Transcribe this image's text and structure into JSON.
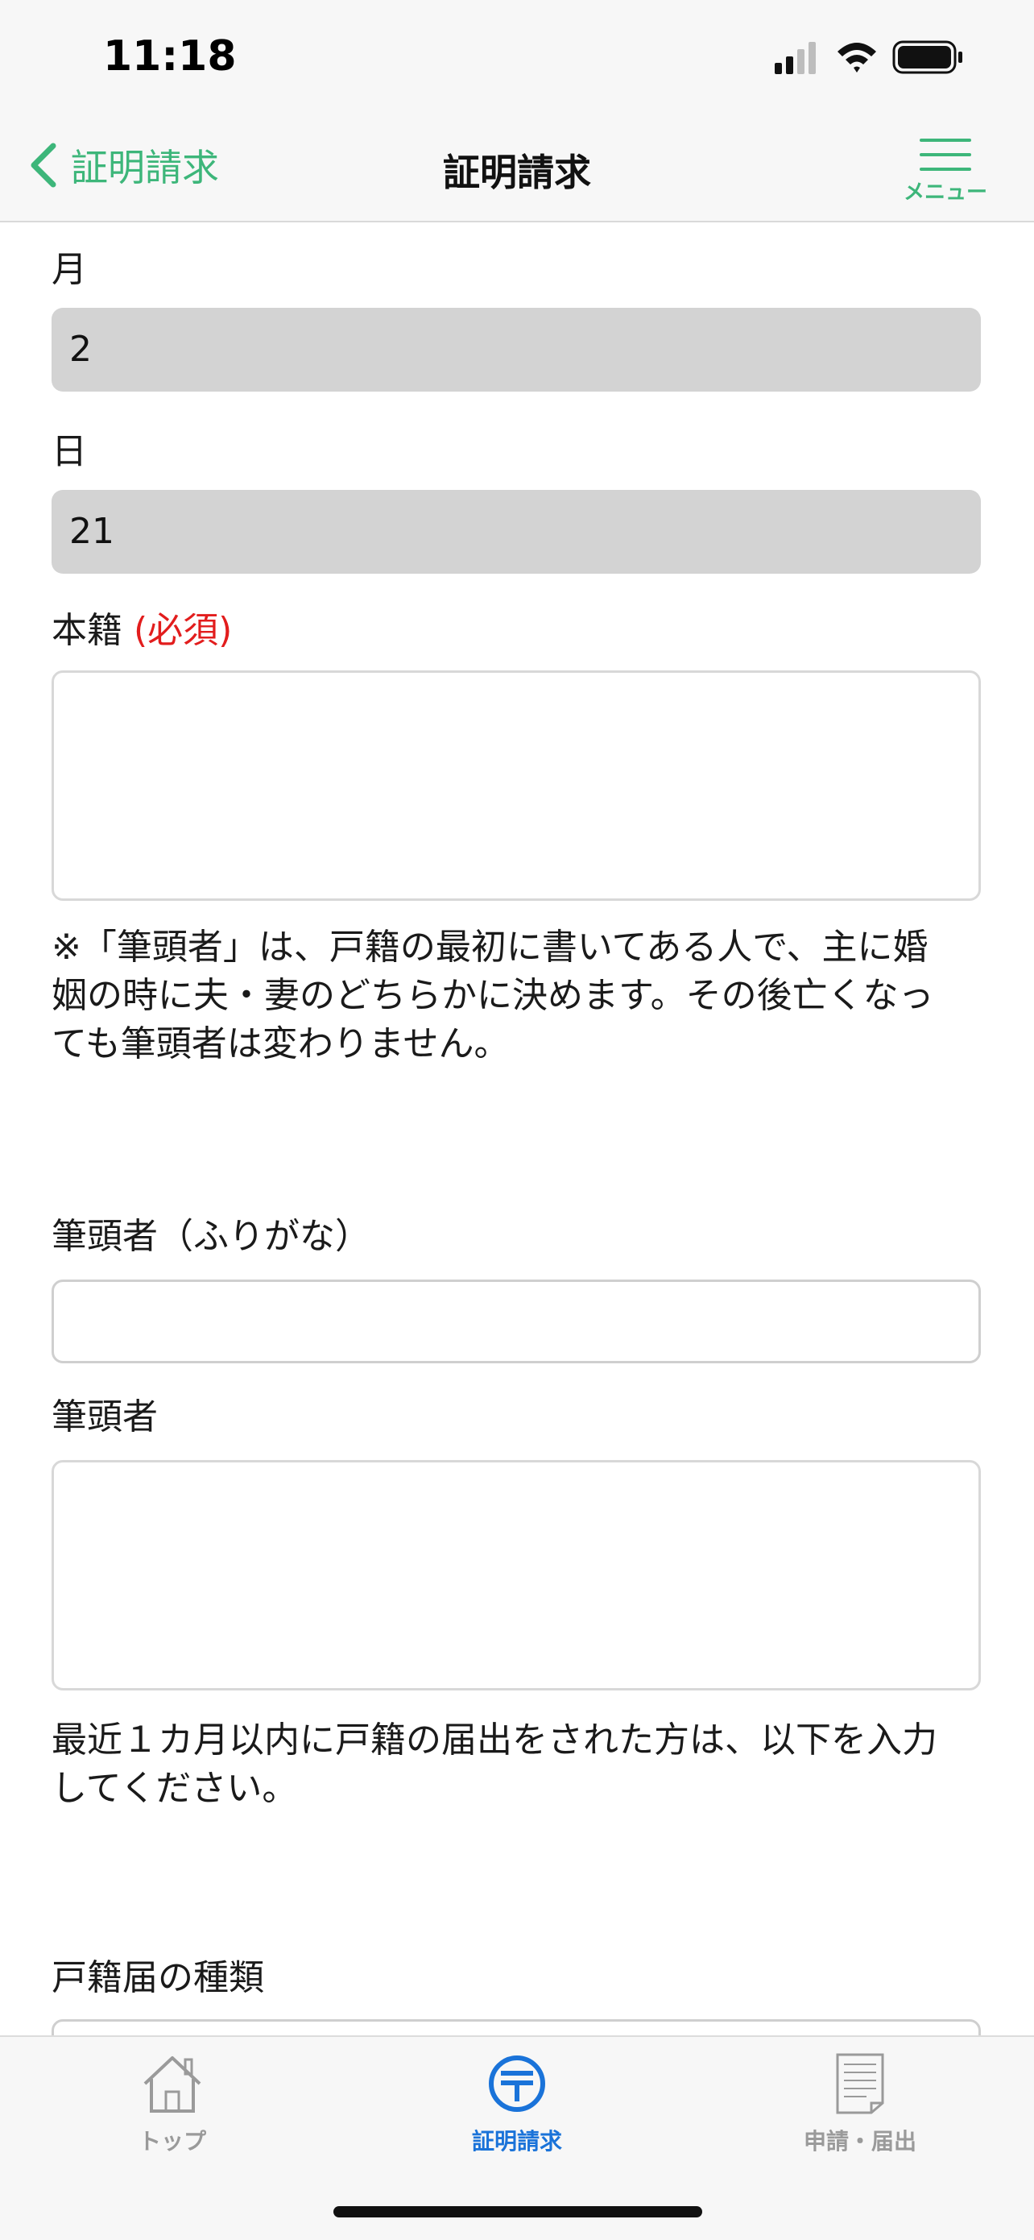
{
  "status_bar": {
    "time": "11:18"
  },
  "nav": {
    "back_label": "証明請求",
    "title": "証明請求",
    "menu_label": "メニュー"
  },
  "form": {
    "month_label": "月",
    "month_value": "2",
    "day_label": "日",
    "day_value": "21",
    "honseki_label": "本籍",
    "required_tag": "(必須)",
    "honseki_value": "",
    "hittousha_note": "※「筆頭者」は、戸籍の最初に書いてある人で、主に婚姻の時に夫・妻のどちらかに決めます。その後亡くなっても筆頭者は変わりません。",
    "hittousha_kana_label": "筆頭者（ふりがな）",
    "hittousha_kana_value": "",
    "hittousha_label": "筆頭者",
    "hittousha_value": "",
    "recent_note": "最近１カ月以内に戸籍の届出をされた方は、以下を入力してください。",
    "todoke_type_label": "戸籍届の種類"
  },
  "tab_bar": {
    "items": [
      {
        "label": "トップ",
        "icon": "house-icon",
        "active": false
      },
      {
        "label": "証明請求",
        "icon": "postal-mark-icon",
        "active": true
      },
      {
        "label": "申請・届出",
        "icon": "document-icon",
        "active": false
      }
    ]
  },
  "colors": {
    "accent_green": "#3db67a",
    "active_blue": "#1a73d9",
    "required_red": "#e21d1d",
    "filled_field": "#d3d3d3"
  }
}
